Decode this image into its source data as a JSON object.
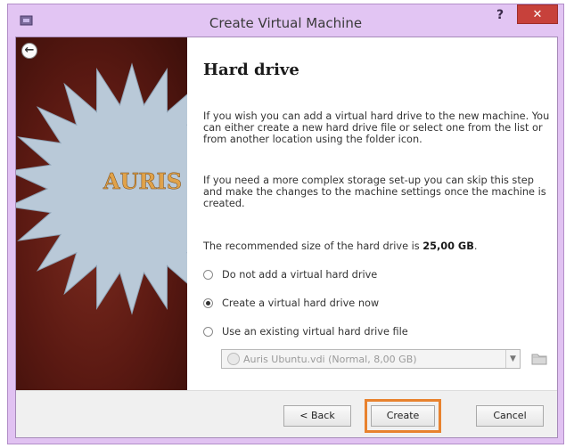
{
  "window": {
    "title": "Create Virtual Machine",
    "help_label": "?",
    "close_label": "✕"
  },
  "banner": {
    "logo_text": "AURIS"
  },
  "page": {
    "heading": "Hard drive",
    "paragraph1": "If you wish you can add a virtual hard drive to the new machine. You can either create a new hard drive file or select one from the list or from another location using the folder icon.",
    "paragraph2": "If you need a more complex storage set-up you can skip this step and make the changes to the machine settings once the machine is created.",
    "recommended_prefix": "The recommended size of the hard drive is ",
    "recommended_size": "25,00 GB",
    "recommended_suffix": "."
  },
  "options": [
    {
      "label": "Do not add a virtual hard drive",
      "checked": false
    },
    {
      "label": "Create a virtual hard drive now",
      "checked": true
    },
    {
      "label": "Use an existing virtual hard drive file",
      "checked": false
    }
  ],
  "disk_select": {
    "value": "Auris Ubuntu.vdi (Normal, 8,00 GB)"
  },
  "buttons": {
    "back": "< Back",
    "create": "Create",
    "cancel": "Cancel"
  },
  "colors": {
    "titlebar": "#e2c5f3",
    "close": "#c7413b",
    "highlight": "#e8822e",
    "banner": "#5a1912",
    "logo": "#e0a24a"
  }
}
